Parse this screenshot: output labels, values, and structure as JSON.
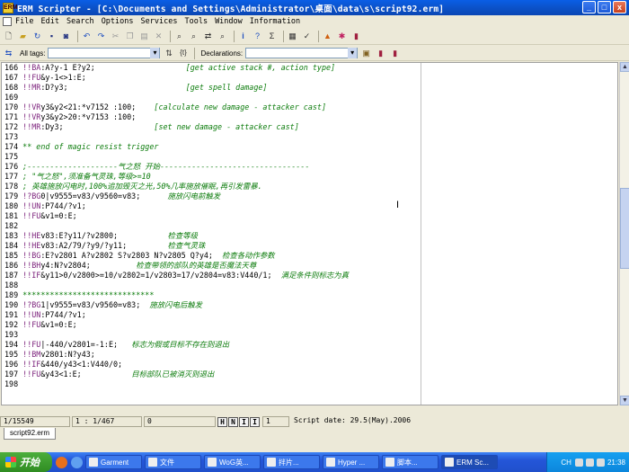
{
  "window": {
    "title": "ERM Scripter - [C:\\Documents and Settings\\Administrator\\桌面\\data\\s\\script92.erm]",
    "app_icon_text": "ERM",
    "buttons": [
      "_",
      "□",
      "x"
    ]
  },
  "menu": [
    "File",
    "Edit",
    "Search",
    "Options",
    "Services",
    "Tools",
    "Window",
    "Information"
  ],
  "toolbar2": {
    "all_tags_label": "All tags:",
    "declarations_label": "Declarations:",
    "braces_icon": "{t}"
  },
  "editor": {
    "lines": [
      {
        "n": "166",
        "cmd": "!!BA",
        "code": ":A?y-1 E?y2;",
        "cmt": "[get active stack #, action type]",
        "col": 36
      },
      {
        "n": "167",
        "cmd": "!!FU",
        "code": "&y-1<>1:E;",
        "cmt": "",
        "col": 0
      },
      {
        "n": "168",
        "cmd": "!!MR",
        "code": ":D?y3;",
        "cmt": "[get spell damage]",
        "col": 36
      },
      {
        "n": "169",
        "cmd": "",
        "code": "",
        "cmt": "",
        "col": 0
      },
      {
        "n": "170",
        "cmd": "!!VR",
        "code": "y3&y2<21:*v7152 :100;",
        "cmt": "[calculate new damage - attacker cast]",
        "col": 29
      },
      {
        "n": "171",
        "cmd": "!!VR",
        "code": "y3&y2>20:*v7153 :100;",
        "cmt": "",
        "col": 0
      },
      {
        "n": "172",
        "cmd": "!!MR",
        "code": ":Dy3;",
        "cmt": "[set new damage - attacker cast]",
        "col": 29
      },
      {
        "n": "173",
        "cmd": "",
        "code": "",
        "cmt": "",
        "col": 0
      },
      {
        "n": "174",
        "cmd": "",
        "code": "",
        "cmt": "** end of magic resist trigger",
        "col": 0
      },
      {
        "n": "175",
        "cmd": "",
        "code": "",
        "cmt": "",
        "col": 0
      },
      {
        "n": "176",
        "cmd": "",
        "code": "",
        "cmt": ";--------------------气之怒 开始---------------------------------",
        "col": 0
      },
      {
        "n": "177",
        "cmd": "",
        "code": "",
        "cmt": "; \"气之怒\",须准备气灵珠,等级>=10",
        "col": 0
      },
      {
        "n": "178",
        "cmd": "",
        "code": "",
        "cmt": "; 英雄施放闪电时,100%追加毁灭之光,50%几率施放催眠,再引发雷暴.",
        "col": 0
      },
      {
        "n": "179",
        "cmd": "!?BG",
        "code": "0|v9555=v83/v9560=v83;",
        "cmt": "施放闪电前触发",
        "col": 32
      },
      {
        "n": "180",
        "cmd": "!!UN",
        "code": ":P744/?v1;",
        "cmt": "",
        "col": 0
      },
      {
        "n": "181",
        "cmd": "!!FU",
        "code": "&v1=0:E;",
        "cmt": "",
        "col": 0
      },
      {
        "n": "182",
        "cmd": "",
        "code": "",
        "cmt": "",
        "col": 0
      },
      {
        "n": "183",
        "cmd": "!!HE",
        "code": "v83:E?y11/?v2800;",
        "cmt": "检查等级",
        "col": 32
      },
      {
        "n": "184",
        "cmd": "!!HE",
        "code": "v83:A2/79/?y9/?y11;",
        "cmt": "检查气灵珠",
        "col": 32
      },
      {
        "n": "185",
        "cmd": "!!BG",
        "code": ":E?v2801 A?v2802 S?v2803 N?v2805 Q?y4;",
        "cmt": "检查各动作参数",
        "col": 32
      },
      {
        "n": "186",
        "cmd": "!!BH",
        "code": "y4:N?v2804;",
        "cmt": "检查带领的部队的英雄是否魔法天尊",
        "col": 25
      },
      {
        "n": "187",
        "cmd": "!!IF",
        "code": "&y11>0/v2800>=10/v2802=1/v2803=17/v2804=v83:V440/1;",
        "cmt": "满足条件则标志为真",
        "col": 0
      },
      {
        "n": "188",
        "cmd": "",
        "code": "",
        "cmt": "",
        "col": 0
      },
      {
        "n": "189",
        "cmd": "",
        "code": "",
        "cmt": "*****************************",
        "col": 0
      },
      {
        "n": "190",
        "cmd": "!?BG",
        "code": "1|v9555=v83/v9560=v83;",
        "cmt": "施放闪电后触发",
        "col": 24
      },
      {
        "n": "191",
        "cmd": "!!UN",
        "code": ":P744/?v1;",
        "cmt": "",
        "col": 0
      },
      {
        "n": "192",
        "cmd": "!!FU",
        "code": "&v1=0:E;",
        "cmt": "",
        "col": 0
      },
      {
        "n": "193",
        "cmd": "",
        "code": "",
        "cmt": "",
        "col": 0
      },
      {
        "n": "194",
        "cmd": "!!FU",
        "code": "|-440/v2801=-1:E;",
        "cmt": "标志为假或目标不存在则退出",
        "col": 24
      },
      {
        "n": "195",
        "cmd": "!!BM",
        "code": "v2801:N?y43;",
        "cmt": "",
        "col": 0
      },
      {
        "n": "196",
        "cmd": "!!IF",
        "code": "&440/y43<1:V440/0;",
        "cmt": "",
        "col": 0
      },
      {
        "n": "197",
        "cmd": "!!FU",
        "code": "&y43<1:E;",
        "cmt": "目标部队已被消灭则退出",
        "col": 24
      },
      {
        "n": "198",
        "cmd": "",
        "code": "",
        "cmt": "",
        "col": 0
      }
    ]
  },
  "statusbar": {
    "position": "1/15549",
    "line": "1 : 1/467",
    "col": "0",
    "nav_buttons": [
      "H",
      "N",
      "I",
      "I"
    ],
    "nav_value": "1",
    "script_date": "Script date: 29.5(May).2006"
  },
  "file_tab": "script92.erm",
  "taskbar": {
    "start": "开始",
    "tasks": [
      "Garment",
      "文件",
      "WoG英...",
      "拌片...",
      "Hyper ...",
      "脚本...",
      "ERM Sc..."
    ],
    "active_task": 6,
    "tray_lang": "CH",
    "clock": "21:38"
  },
  "icons": {
    "toolbar1": [
      "new-file-icon",
      "open-folder-icon",
      "reload-icon",
      "save-icon",
      "save-all-icon",
      "undo-icon",
      "redo-icon",
      "cut-icon",
      "copy-icon",
      "paste-icon",
      "delete-icon",
      "find-icon",
      "find-next-icon",
      "replace-icon",
      "find-files-icon",
      "info-icon",
      "help-icon",
      "sum-icon",
      "window-icon",
      "check-icon",
      "warning-icon",
      "bug-icon",
      "book-icon"
    ]
  }
}
